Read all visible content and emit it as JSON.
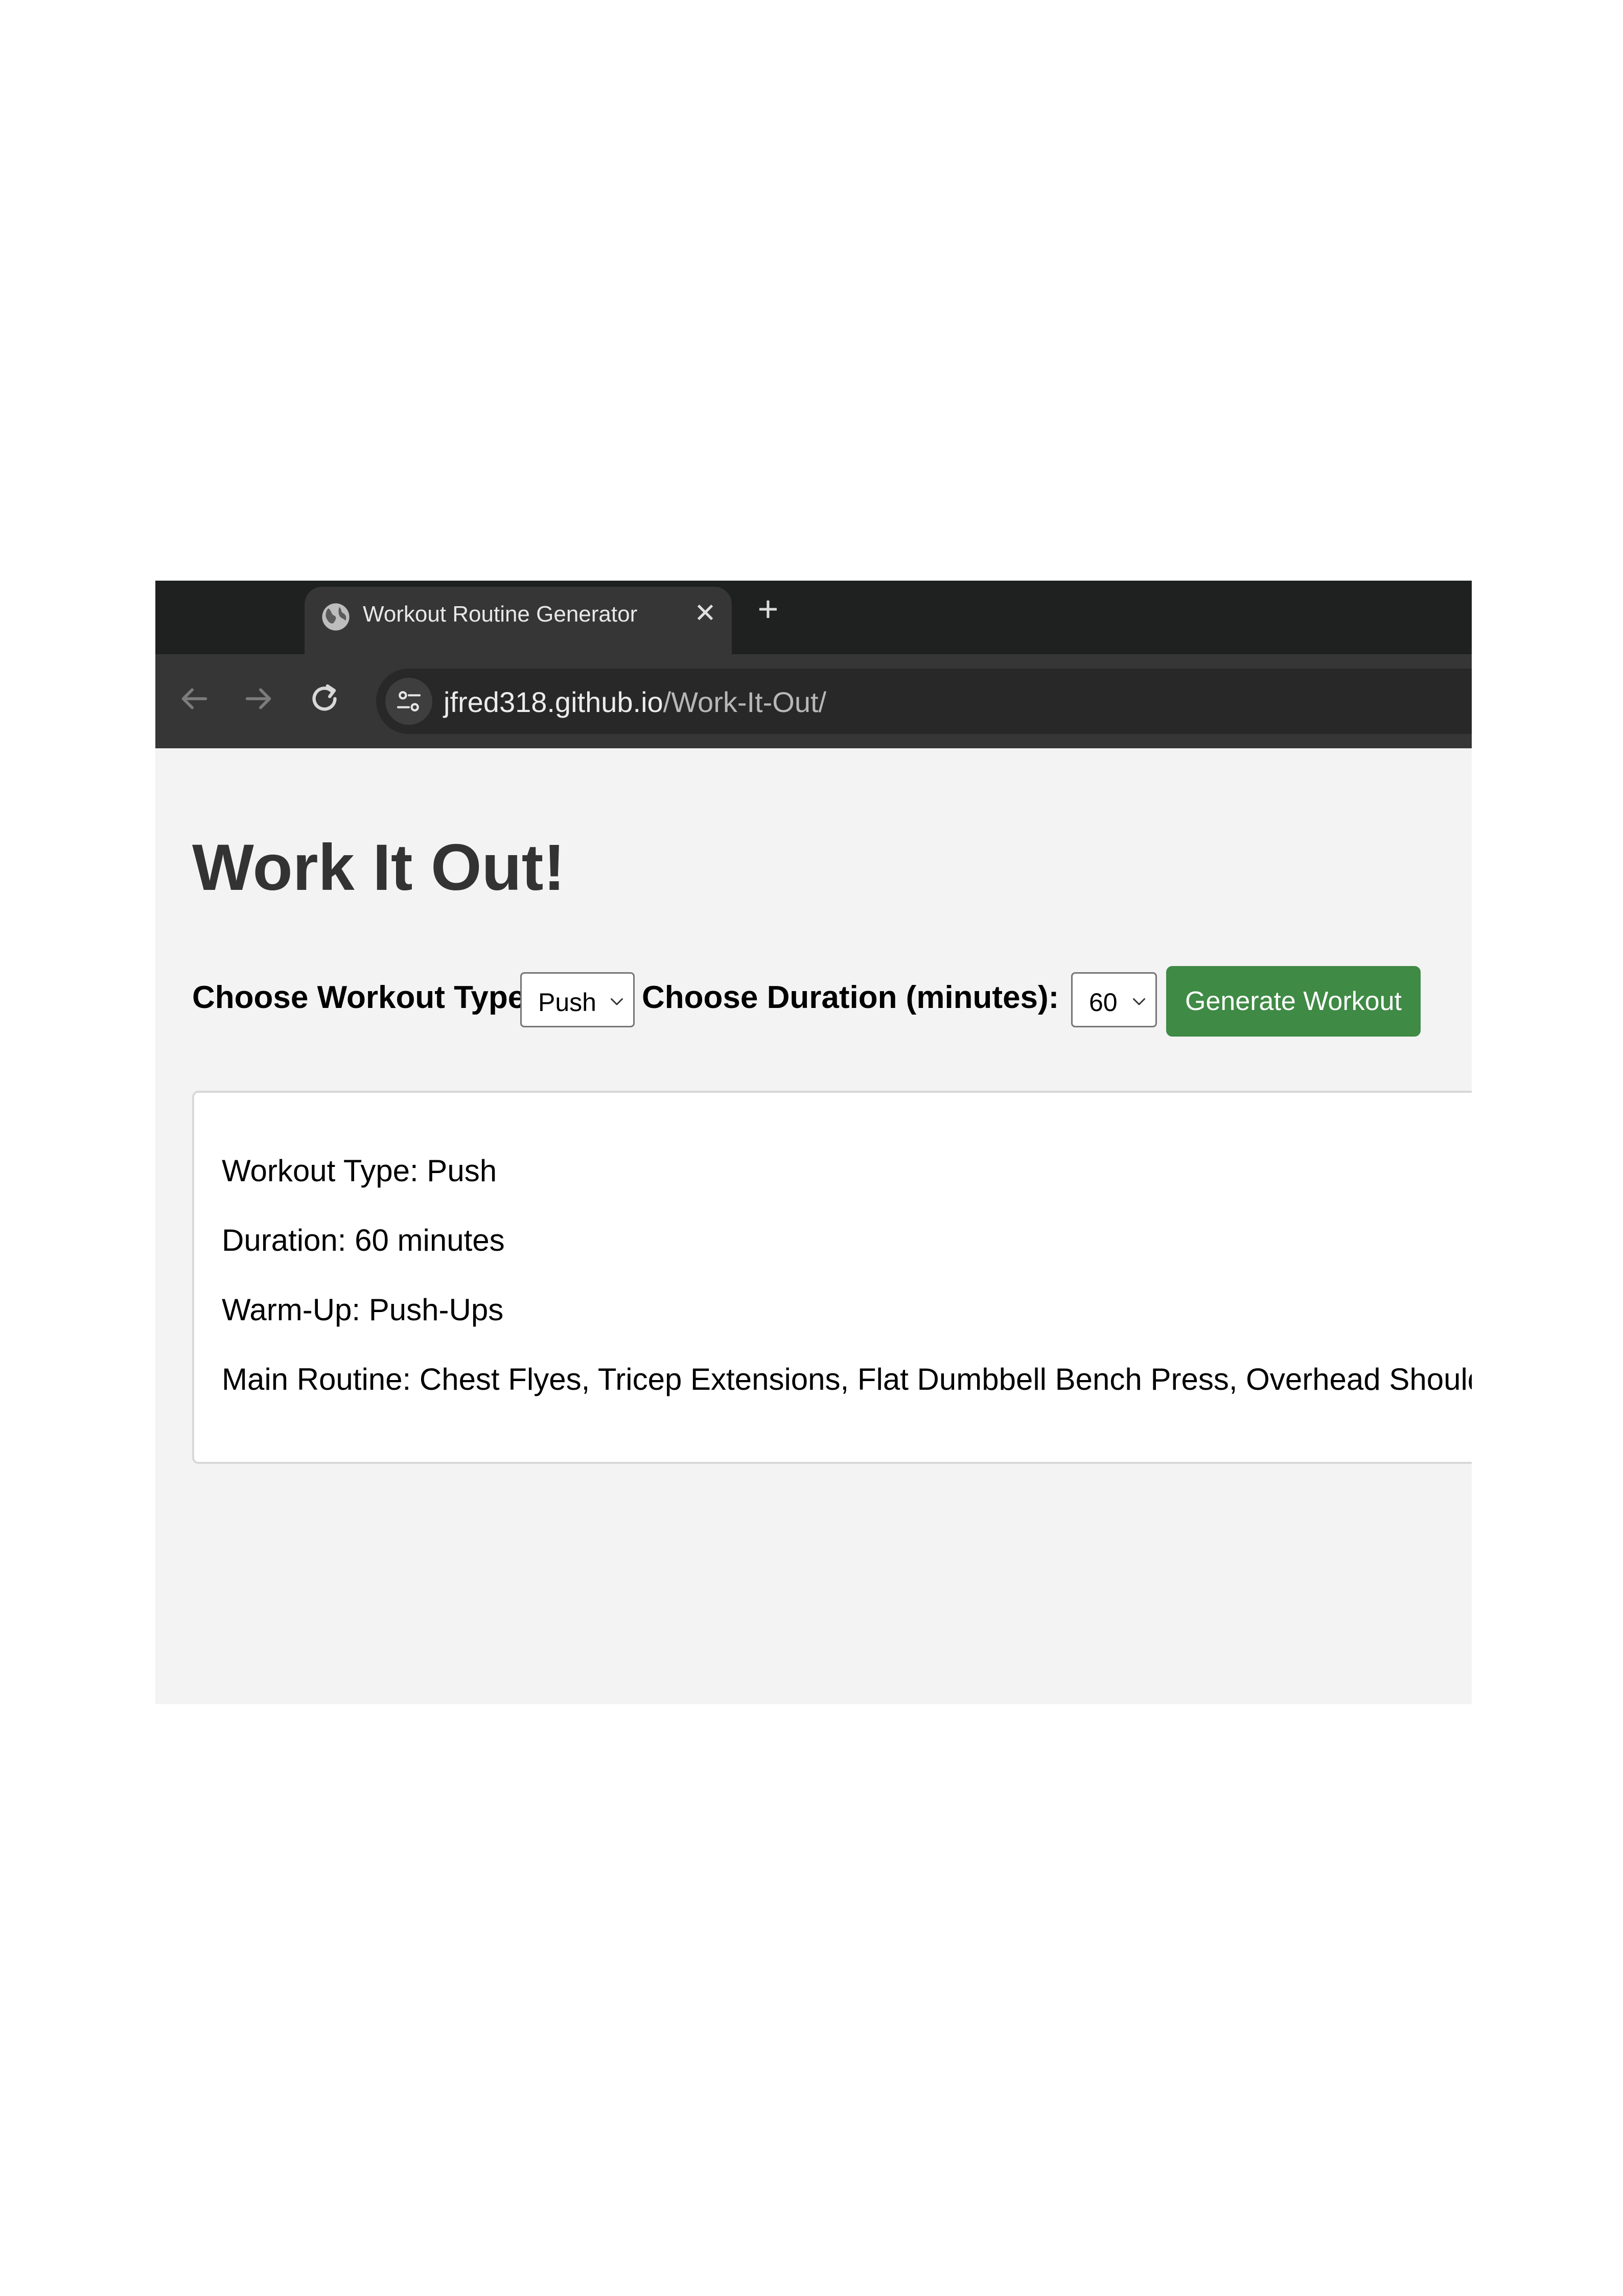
{
  "browser": {
    "tab": {
      "title": "Workout Routine Generator",
      "favicon": "globe-icon",
      "close": "✕"
    },
    "new_tab": "+",
    "nav": {
      "back": "back-arrow-icon",
      "forward": "forward-arrow-icon",
      "reload": "reload-icon"
    },
    "site_info_icon": "tune-icon",
    "url": {
      "host": "jfred318.github.io",
      "path": "/Work-It-Out/"
    }
  },
  "page": {
    "title": "Work It Out!",
    "controls": {
      "workout_type_label": "Choose Workout Type:",
      "workout_type_value": "Push",
      "duration_label": "Choose Duration (minutes):",
      "duration_value": "60",
      "generate_label": "Generate Workout"
    },
    "result": {
      "workout_type": "Workout Type: Push",
      "duration": "Duration: 60 minutes",
      "warm_up": "Warm-Up: Push-Ups",
      "main_routine": "Main Routine: Chest Flyes, Tricep Extensions, Flat Dumbbell Bench Press, Overhead Shoulder P"
    }
  },
  "colors": {
    "tabstrip": "#1f2020",
    "toolbar": "#363636",
    "page_bg": "#f3f3f3",
    "title": "#333333",
    "button": "#3f8a45"
  }
}
